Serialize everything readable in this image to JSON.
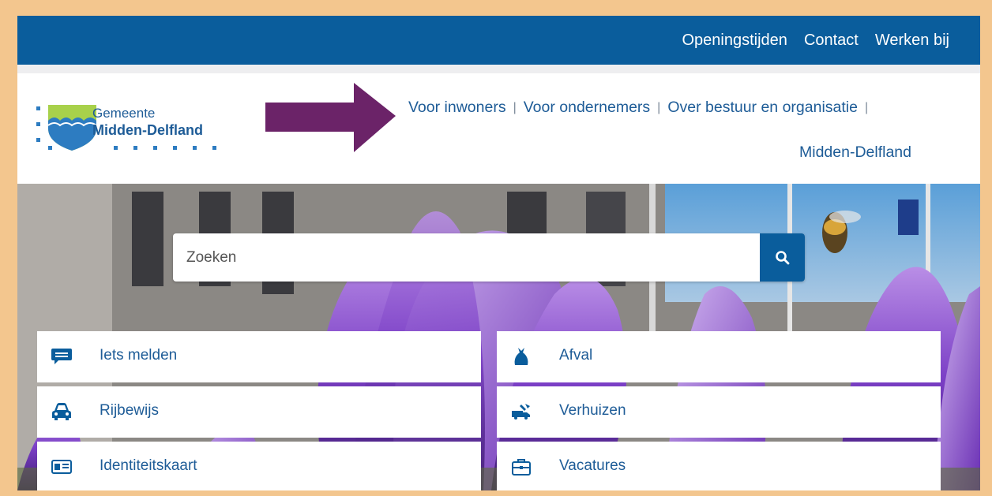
{
  "topbar": {
    "links": [
      "Openingstijden",
      "Contact",
      "Werken bij"
    ]
  },
  "logo": {
    "line1": "Gemeente",
    "line2": "Midden-Delfland"
  },
  "mainnav": {
    "items": [
      "Voor inwoners",
      "Voor ondernemers",
      "Over bestuur en organisatie",
      "Midden-Delfland"
    ],
    "separator": "|"
  },
  "search": {
    "placeholder": "Zoeken",
    "icon": "search-icon"
  },
  "tiles": [
    {
      "label": "Iets melden",
      "icon": "chat-bubble-icon"
    },
    {
      "label": "Afval",
      "icon": "garbage-bag-icon"
    },
    {
      "label": "Rijbewijs",
      "icon": "car-icon"
    },
    {
      "label": "Verhuizen",
      "icon": "moving-truck-icon"
    },
    {
      "label": "Identiteitskaart",
      "icon": "id-card-icon"
    },
    {
      "label": "Vacatures",
      "icon": "briefcase-icon"
    }
  ],
  "colors": {
    "primary": "#0a5d9c",
    "text": "#1e5c97",
    "frame": "#f3c68e",
    "arrow": "#6b2368",
    "logo_green": "#a8d14b",
    "logo_blue": "#2d7cc1"
  }
}
